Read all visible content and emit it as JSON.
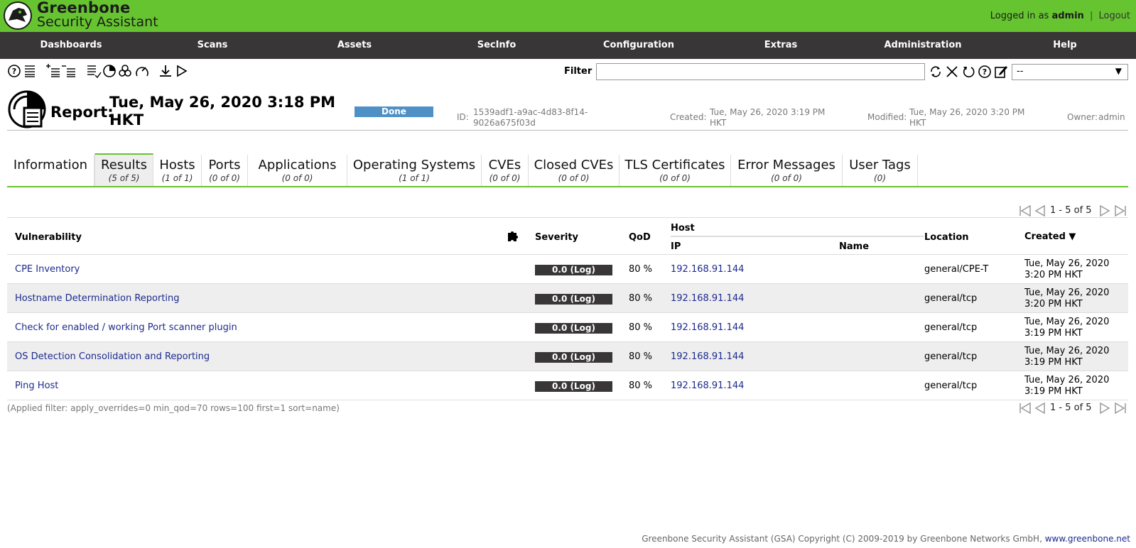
{
  "header": {
    "brand_line1": "Greenbone",
    "brand_line2": "Security Assistant",
    "logged_in_prefix": "Logged in as",
    "user": "admin",
    "separator": "|",
    "logout": "Logout"
  },
  "nav": [
    "Dashboards",
    "Scans",
    "Assets",
    "SecInfo",
    "Configuration",
    "Extras",
    "Administration",
    "Help"
  ],
  "toolbar": {
    "icons": [
      "help-icon",
      "list-icon",
      "add-to-assets-icon",
      "remove-from-assets-icon",
      "results-list-icon",
      "scan-task-icon",
      "biohazard-icon",
      "delta-icon",
      "download-icon",
      "trigger-alert-icon"
    ],
    "filter_label": "Filter",
    "filter_value": "",
    "filter_icons": [
      "refresh-icon",
      "clear-icon",
      "reset-icon",
      "help-icon",
      "edit-icon"
    ],
    "select_value": "--"
  },
  "report": {
    "label": "Report:",
    "date": "Tue, May 26, 2020 3:18 PM HKT",
    "status": "Done",
    "id_label": "ID:",
    "id_value": "1539adf1-a9ac-4d83-8f14-9026a675f03d",
    "created_label": "Created:",
    "created_value": "Tue, May 26, 2020 3:19 PM HKT",
    "modified_label": "Modified:",
    "modified_value": "Tue, May 26, 2020 3:20 PM HKT",
    "owner_label": "Owner:",
    "owner_value": "admin"
  },
  "tabs": [
    {
      "label": "Information",
      "count": ""
    },
    {
      "label": "Results",
      "count": "(5 of 5)"
    },
    {
      "label": "Hosts",
      "count": "(1 of 1)"
    },
    {
      "label": "Ports",
      "count": "(0 of 0)"
    },
    {
      "label": "Applications",
      "count": "(0 of 0)"
    },
    {
      "label": "Operating Systems",
      "count": "(1 of 1)"
    },
    {
      "label": "CVEs",
      "count": "(0 of 0)"
    },
    {
      "label": "Closed CVEs",
      "count": "(0 of 0)"
    },
    {
      "label": "TLS Certificates",
      "count": "(0 of 0)"
    },
    {
      "label": "Error Messages",
      "count": "(0 of 0)"
    },
    {
      "label": "User Tags",
      "count": "(0)"
    }
  ],
  "pagination": {
    "text": "1 - 5 of 5"
  },
  "table": {
    "headers": {
      "vulnerability": "Vulnerability",
      "severity": "Severity",
      "qod": "QoD",
      "host": "Host",
      "ip": "IP",
      "name": "Name",
      "location": "Location",
      "created": "Created ▼"
    },
    "rows": [
      {
        "vulnerability": "CPE Inventory",
        "severity": "0.0 (Log)",
        "qod": "80 %",
        "ip": "192.168.91.144",
        "name": "",
        "location": "general/CPE-T",
        "created1": "Tue, May 26, 2020",
        "created2": "3:20 PM HKT"
      },
      {
        "vulnerability": "Hostname Determination Reporting",
        "severity": "0.0 (Log)",
        "qod": "80 %",
        "ip": "192.168.91.144",
        "name": "",
        "location": "general/tcp",
        "created1": "Tue, May 26, 2020",
        "created2": "3:20 PM HKT"
      },
      {
        "vulnerability": "Check for enabled / working Port scanner plugin",
        "severity": "0.0 (Log)",
        "qod": "80 %",
        "ip": "192.168.91.144",
        "name": "",
        "location": "general/tcp",
        "created1": "Tue, May 26, 2020",
        "created2": "3:19 PM HKT"
      },
      {
        "vulnerability": "OS Detection Consolidation and Reporting",
        "severity": "0.0 (Log)",
        "qod": "80 %",
        "ip": "192.168.91.144",
        "name": "",
        "location": "general/tcp",
        "created1": "Tue, May 26, 2020",
        "created2": "3:19 PM HKT"
      },
      {
        "vulnerability": "Ping Host",
        "severity": "0.0 (Log)",
        "qod": "80 %",
        "ip": "192.168.91.144",
        "name": "",
        "location": "general/tcp",
        "created1": "Tue, May 26, 2020",
        "created2": "3:19 PM HKT"
      }
    ]
  },
  "applied_filter": "(Applied filter: apply_overrides=0 min_qod=70 rows=100 first=1 sort=name)",
  "footer": {
    "text": "Greenbone Security Assistant (GSA) Copyright (C) 2009-2019 by Greenbone Networks GmbH,",
    "link": "www.greenbone.net"
  },
  "colors": {
    "brand_green": "#66c430",
    "nav_dark": "#393637",
    "done_blue": "#4f91c7",
    "link": "#1d2a8e"
  }
}
